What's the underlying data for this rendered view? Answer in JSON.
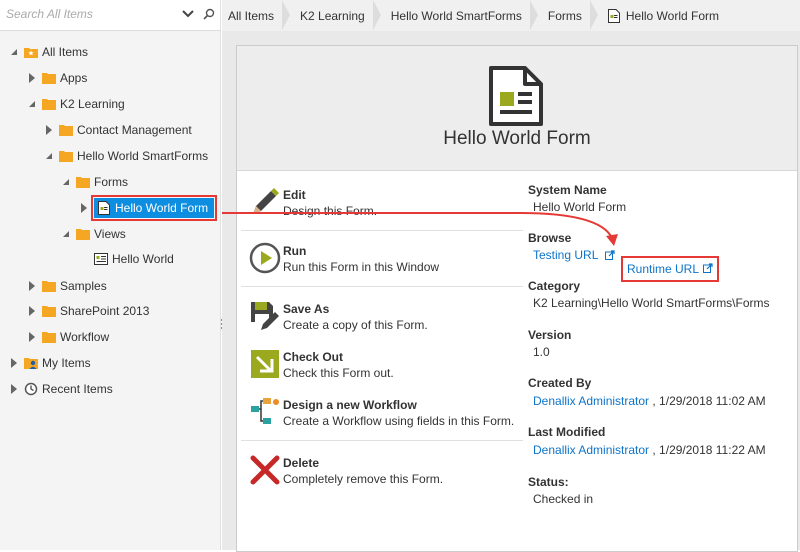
{
  "search": {
    "placeholder": "Search All Items"
  },
  "tree": {
    "all_items": "All Items",
    "apps": "Apps",
    "k2_learning": "K2 Learning",
    "contact_management": "Contact Management",
    "hello_world_smartforms": "Hello World SmartForms",
    "forms": "Forms",
    "hello_world_form": "Hello World Form",
    "views": "Views",
    "hello_world_view": "Hello World",
    "samples": "Samples",
    "sharepoint_2013": "SharePoint 2013",
    "workflow": "Workflow",
    "my_items": "My Items",
    "recent_items": "Recent Items"
  },
  "breadcrumb": [
    "All Items",
    "K2 Learning",
    "Hello World SmartForms",
    "Forms",
    "Hello World Form"
  ],
  "header": {
    "title": "Hello World Form"
  },
  "actions": [
    {
      "title": "Edit",
      "desc": "Design this Form."
    },
    {
      "title": "Run",
      "desc": "Run this Form in this Window"
    },
    {
      "title": "Save As",
      "desc": "Create a copy of this Form."
    },
    {
      "title": "Check Out",
      "desc": "Check this Form out."
    },
    {
      "title": "Design a new Workflow",
      "desc": "Create a Workflow using fields in this Form."
    },
    {
      "title": "Delete",
      "desc": "Completely remove this Form."
    }
  ],
  "properties": {
    "system_name_label": "System Name",
    "system_name": "Hello World Form",
    "browse_label": "Browse",
    "testing_url": "Testing URL",
    "runtime_url": "Runtime URL",
    "category_label": "Category",
    "category": "K2 Learning\\Hello World SmartForms\\Forms",
    "version_label": "Version",
    "version": "1.0",
    "created_by_label": "Created By",
    "created_by_user": "Denallix Administrator",
    "created_date": ", 1/29/2018 11:02 AM",
    "last_modified_label": "Last Modified",
    "modified_by_user": "Denallix Administrator",
    "modified_date": ", 1/29/2018 11:22 AM",
    "status_label": "Status:",
    "status": "Checked in"
  },
  "icons": {
    "folder": "folder-icon",
    "form": "form-icon",
    "view": "view-icon",
    "user": "user-icon",
    "clock": "clock-icon"
  },
  "colors": {
    "selection": "#0e8ee0",
    "highlight": "#e53935",
    "link": "#0e74c9",
    "folder": "#f5a623"
  }
}
